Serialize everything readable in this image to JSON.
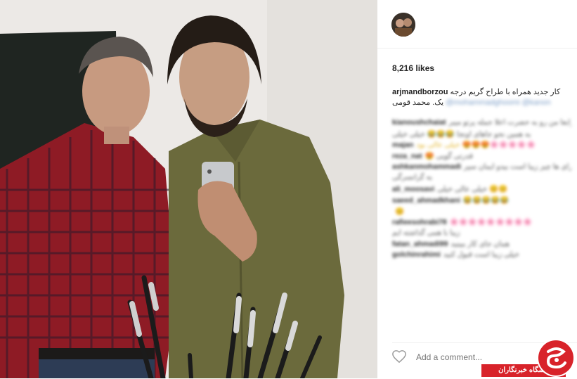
{
  "post": {
    "username": "arjmandborzou",
    "likes": "8,216 likes",
    "caption_text": "کار جدید همراه با طراح گریم درجه یک. محمد قومی",
    "caption_mention": "@mohammadghoomi @kanon",
    "icons": {
      "avatar": "avatar",
      "like": "heart-icon"
    }
  },
  "comments": [
    {
      "user": "kianoushchaiat",
      "text": "رابعا من رو به حضرت اعلا جمله پرتو میبر"
    },
    {
      "user": "",
      "text": "به همین نحو جاهای اونجا  😂😂😂 خیلی خیلی"
    },
    {
      "user": "majan",
      "text": "خیلی عالی بود 😍😍😍🌸🌸🌸🌸🌸"
    },
    {
      "user": "reza_nat",
      "text": "😍 قدرتی گویی"
    },
    {
      "user": "ashkanmohammadi",
      "text": "رای ها چیز زیبا است بیدو ایمان سپر"
    },
    {
      "user": "",
      "text": "به گرانسرگی"
    },
    {
      "user": "ali_moosavi",
      "text": "خیلی عالی خیلی 😊😊"
    },
    {
      "user": "saeed_ahmadkhani",
      "text": "😂😂😂😂😂"
    },
    {
      "user": "",
      "text": "😊"
    },
    {
      "user": "rafieesohrabi78",
      "text": "🌸🌸🌸🌸🌸🌸🌸🌸🌸"
    },
    {
      "user": "",
      "text": "زیبا با همی گذاشته ایم"
    },
    {
      "user": "fatan_ahmadi99",
      "text": "همان جای کار ببینید"
    },
    {
      "user": "golchinrahimi",
      "text": "خیلی زیبا است قبول کنید"
    }
  ],
  "comment_box": {
    "placeholder": "Add a comment..."
  },
  "watermark": {
    "text": "باشگاه خبرنگاران"
  },
  "colors": {
    "brand_red": "#d8232a",
    "link_blue": "#7b9dc7",
    "divider": "#efefef"
  }
}
